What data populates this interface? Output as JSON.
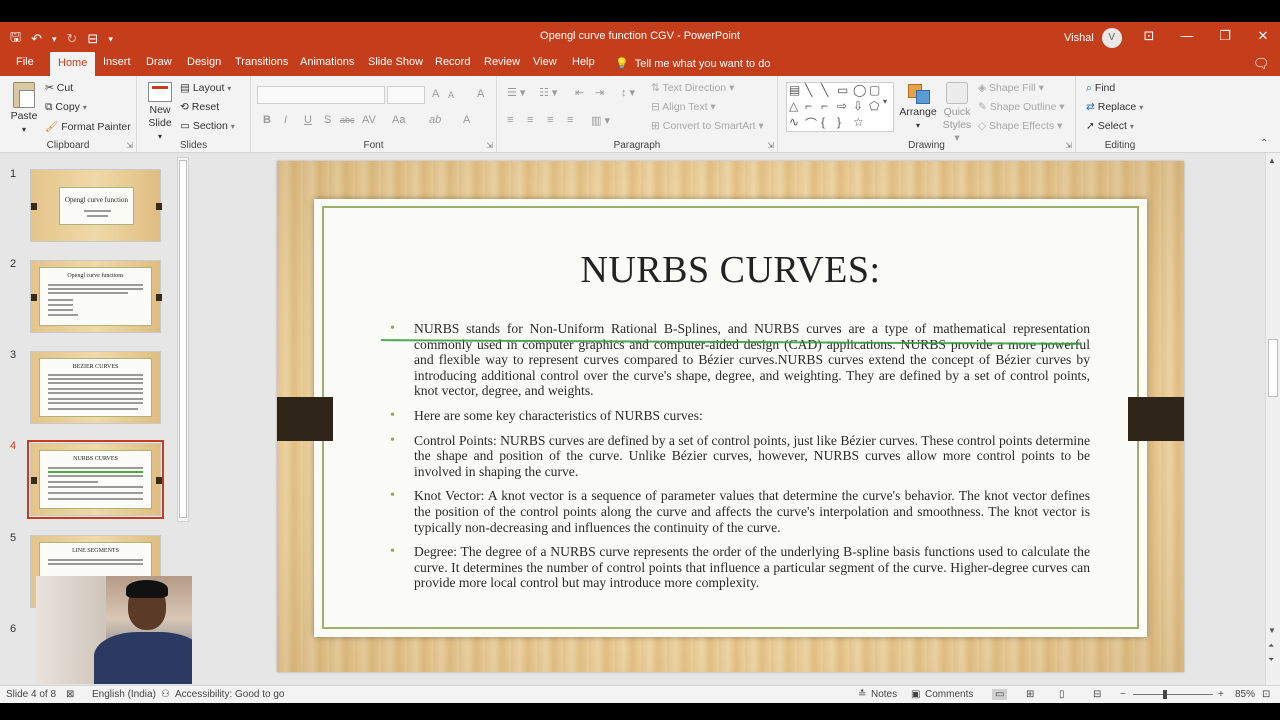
{
  "window": {
    "title": "Opengl curve function CGV  -  PowerPoint",
    "user": "Vishal",
    "avatar_initial": "V",
    "controls": [
      "⊡",
      "—",
      "❐",
      "✕"
    ]
  },
  "qat": {
    "save": "🖫",
    "undo": "↶",
    "undo_drop": "▾",
    "redo": "↻",
    "present": "⊟",
    "customize": "▾"
  },
  "tabs": [
    "File",
    "Home",
    "Insert",
    "Draw",
    "Design",
    "Transitions",
    "Animations",
    "Slide Show",
    "Record",
    "Review",
    "View",
    "Help"
  ],
  "tell_me": {
    "icon": "💡",
    "text": "Tell me what you want to do"
  },
  "ribbon": {
    "clipboard": {
      "label": "Clipboard",
      "paste": "Paste",
      "paste_drop": "▾",
      "cut": "Cut",
      "copy": "Copy",
      "format_painter": "Format Painter"
    },
    "slides": {
      "label": "Slides",
      "new_slide": "New",
      "new_slide2": "Slide",
      "layout": "Layout",
      "reset": "Reset",
      "section": "Section"
    },
    "font": {
      "label": "Font",
      "bold": "B",
      "italic": "I",
      "underline": "U",
      "strike": "S",
      "shadow": "abc",
      "spacing": "AV",
      "case": "Aa",
      "grow": "A",
      "shrink": "A",
      "clear": "A",
      "highlight": "ab",
      "color": "A"
    },
    "paragraph": {
      "label": "Paragraph",
      "text_direction": "Text Direction",
      "align_text": "Align Text",
      "smartart": "Convert to SmartArt"
    },
    "drawing": {
      "label": "Drawing",
      "arrange": "Arrange",
      "quick_styles": "Quick",
      "quick_styles2": "Styles",
      "fill": "Shape Fill",
      "outline": "Shape Outline",
      "effects": "Shape Effects"
    },
    "editing": {
      "label": "Editing",
      "find": "Find",
      "replace": "Replace",
      "select": "Select"
    }
  },
  "thumbnails": [
    {
      "num": "1",
      "title": "Opengl curve function"
    },
    {
      "num": "2",
      "title": "Opengl curve functions"
    },
    {
      "num": "3",
      "title": "BEZIER CURVES"
    },
    {
      "num": "4",
      "title": "NURBS CURVES"
    },
    {
      "num": "5",
      "title": "LINE SEGMENTS"
    },
    {
      "num": "6",
      "title": ""
    }
  ],
  "slide": {
    "title": "NURBS CURVES:",
    "bullets": [
      "NURBS stands for Non-Uniform Rational B-Splines, and NURBS curves are a type of mathematical representation commonly used in computer graphics and computer-aided design (CAD) applications. NURBS provide a more powerful and flexible way to represent curves compared to Bézier curves.NURBS curves extend the concept of Bézier curves by introducing additional control over the curve's shape, degree, and weighting. They are defined by a set of control points, knot vector, degree, and weights.",
      "Here are some key characteristics of NURBS curves:",
      "Control Points: NURBS curves are defined by a set of control points, just like Bézier curves. These control points determine the shape and position of the curve. Unlike Bézier curves, however, NURBS curves allow more control points to be involved in shaping the curve.",
      "Knot Vector: A knot vector is a sequence of parameter values that determine the curve's behavior. The knot vector defines the position of the control points along the curve and affects the curve's interpolation and smoothness. The knot vector is typically non-decreasing and influences the continuity of the curve.",
      "Degree: The degree of a NURBS curve represents the order of the underlying B-spline basis functions used to calculate the curve. It determines the number of control points that influence a particular segment of the curve. Higher-degree curves can provide more local control but may introduce more complexity."
    ]
  },
  "status": {
    "slide_info": "Slide 4 of 8",
    "language": "English (India)",
    "accessibility": "Accessibility: Good to go",
    "notes": "Notes",
    "comments": "Comments",
    "zoom": "85%",
    "zoom_minus": "−",
    "zoom_plus": "+"
  },
  "colors": {
    "accent": "#c43e1c",
    "bullet": "#8fa84a",
    "card_border": "#9fae6b"
  }
}
